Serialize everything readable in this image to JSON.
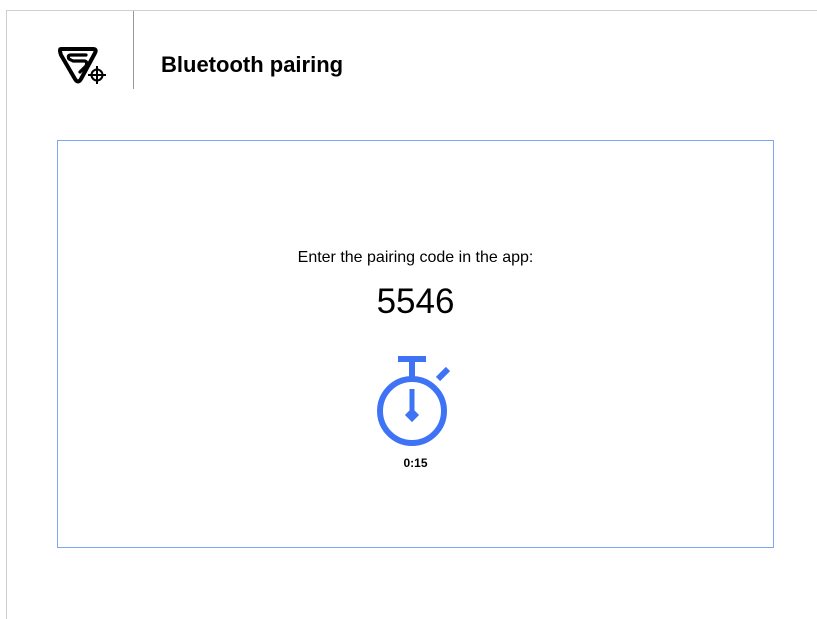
{
  "header": {
    "logo_icon": "brand-logo-shield-crosshair-icon",
    "title": "Bluetooth pairing"
  },
  "pairing": {
    "instruction": "Enter the pairing code in the app:",
    "code": "5546",
    "timer_icon": "stopwatch-icon",
    "timer_value": "0:15"
  },
  "colors": {
    "accent": "#3f73f5",
    "panel_border": "#7ea4ff",
    "frame_border": "#cfcfcf",
    "divider": "#9a9a9a",
    "text": "#000000"
  }
}
